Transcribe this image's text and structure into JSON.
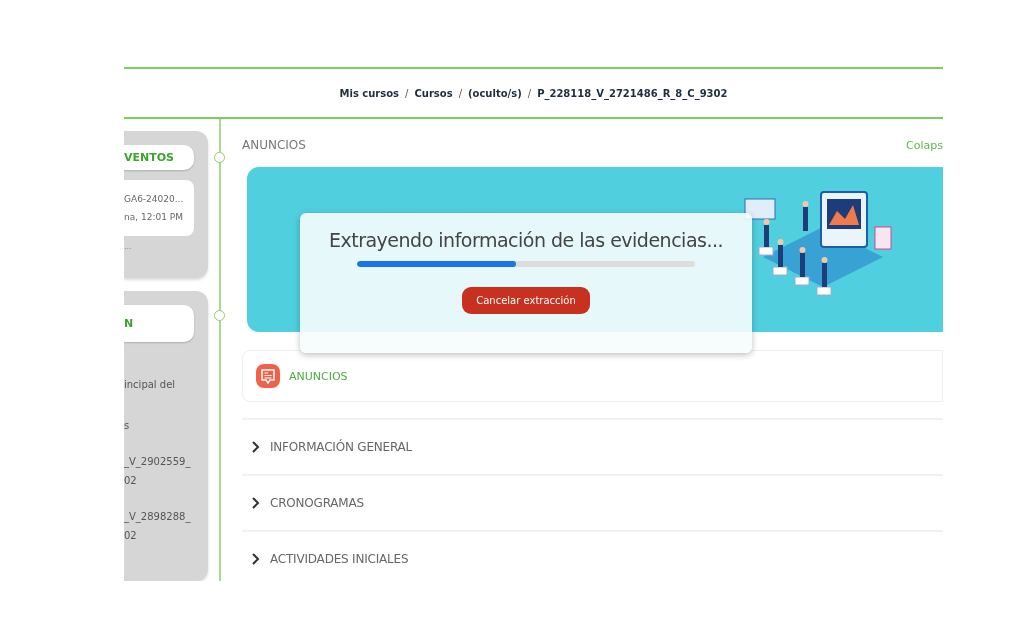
{
  "breadcrumb": {
    "separator": "/",
    "items": [
      {
        "label": "Mis cursos"
      },
      {
        "label": "Cursos"
      },
      {
        "label": "(oculto/s)"
      },
      {
        "label": "P_228118_V_2721486_R_8_C_9302"
      }
    ]
  },
  "sidebar": {
    "blocks": [
      {
        "heading": "VENTOS",
        "lines": [
          "GA6-24020...",
          "na, 12:01 PM"
        ],
        "footer": "..."
      },
      {
        "heading": "N",
        "lines": [
          "incipal del",
          "s",
          "_V_2902559_",
          "02",
          "_V_2898288_",
          "02"
        ]
      }
    ]
  },
  "main": {
    "section_label": "ANUNCIOS",
    "collapse_link": "Colaps",
    "modal": {
      "message": "Extrayendo información de las evidencias...",
      "progress": {
        "level": 0.47
      },
      "button": "Cancelar extracción"
    },
    "forum": {
      "label": "ANUNCIOS"
    },
    "sections": [
      {
        "title": "INFORMACIÓN GENERAL",
        "expanded": false
      },
      {
        "title": "CRONOGRAMAS",
        "expanded": false
      },
      {
        "title": "ACTIVIDADES INICIALES",
        "expanded": false
      }
    ]
  }
}
